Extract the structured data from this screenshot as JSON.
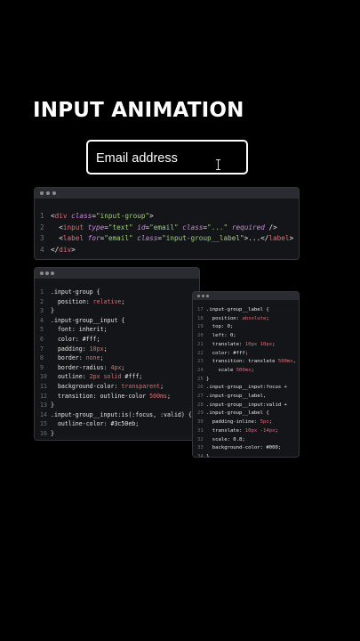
{
  "title": "INPUT ANIMATION",
  "input": {
    "label": "Email address"
  },
  "icons": {
    "cursor": "text-cursor-icon"
  },
  "window1": {
    "lines": [
      {
        "n": "1",
        "segs": [
          [
            "t",
            "<"
          ],
          [
            "tag",
            "div"
          ],
          [
            "t",
            " "
          ],
          [
            "attr",
            "class"
          ],
          [
            "t",
            "="
          ],
          [
            "str",
            "\"input-group\""
          ],
          [
            "t",
            ">"
          ]
        ]
      },
      {
        "n": "2",
        "segs": [
          [
            "t",
            "  <"
          ],
          [
            "tag",
            "input"
          ],
          [
            "t",
            " "
          ],
          [
            "attr",
            "type"
          ],
          [
            "t",
            "="
          ],
          [
            "str",
            "\"text\""
          ],
          [
            "t",
            " "
          ],
          [
            "attr",
            "id"
          ],
          [
            "t",
            "="
          ],
          [
            "str",
            "\"email\""
          ],
          [
            "t",
            " "
          ],
          [
            "attr",
            "class"
          ],
          [
            "t",
            "="
          ],
          [
            "str",
            "\"...\""
          ],
          [
            "t",
            " "
          ],
          [
            "attr",
            "required"
          ],
          [
            "t",
            " />"
          ]
        ]
      },
      {
        "n": "3",
        "segs": [
          [
            "t",
            "  <"
          ],
          [
            "tag",
            "label"
          ],
          [
            "t",
            " "
          ],
          [
            "attr",
            "for"
          ],
          [
            "t",
            "="
          ],
          [
            "str",
            "\"email\""
          ],
          [
            "t",
            " "
          ],
          [
            "attr",
            "class"
          ],
          [
            "t",
            "="
          ],
          [
            "str",
            "\"input-group__label\""
          ],
          [
            "t",
            ">...</"
          ],
          [
            "tag",
            "label"
          ],
          [
            "t",
            ">"
          ]
        ]
      },
      {
        "n": "4",
        "segs": [
          [
            "t",
            "</"
          ],
          [
            "tag",
            "div"
          ],
          [
            "t",
            ">"
          ]
        ]
      }
    ]
  },
  "window2": {
    "lines": [
      {
        "n": "1",
        "segs": [
          [
            "t",
            ".input-group {"
          ]
        ]
      },
      {
        "n": "2",
        "segs": [
          [
            "t",
            "  position: "
          ],
          [
            "kw",
            "relative"
          ],
          [
            "t",
            ";"
          ]
        ]
      },
      {
        "n": "3",
        "segs": [
          [
            "t",
            "}"
          ]
        ]
      },
      {
        "n": "4",
        "segs": [
          [
            "t",
            ".input-group__input {"
          ]
        ]
      },
      {
        "n": "5",
        "segs": [
          [
            "t",
            "  font: inherit;"
          ]
        ]
      },
      {
        "n": "6",
        "segs": [
          [
            "t",
            "  color: #fff;"
          ]
        ]
      },
      {
        "n": "7",
        "segs": [
          [
            "t",
            "  padding: "
          ],
          [
            "kw",
            "10px"
          ],
          [
            "t",
            ";"
          ]
        ]
      },
      {
        "n": "8",
        "segs": [
          [
            "t",
            "  border: "
          ],
          [
            "kw",
            "none"
          ],
          [
            "t",
            ";"
          ]
        ]
      },
      {
        "n": "9",
        "segs": [
          [
            "t",
            "  border-radius: "
          ],
          [
            "kw",
            "4px"
          ],
          [
            "t",
            ";"
          ]
        ]
      },
      {
        "n": "10",
        "segs": [
          [
            "t",
            "  outline: "
          ],
          [
            "kw",
            "2px"
          ],
          [
            "t",
            " "
          ],
          [
            "kw",
            "solid"
          ],
          [
            "t",
            " #fff;"
          ]
        ]
      },
      {
        "n": "11",
        "segs": [
          [
            "t",
            "  background-color: "
          ],
          [
            "kw",
            "transparent"
          ],
          [
            "t",
            ";"
          ]
        ]
      },
      {
        "n": "12",
        "segs": [
          [
            "t",
            "  transition: outline-color "
          ],
          [
            "kw",
            "500ms"
          ],
          [
            "t",
            ";"
          ]
        ]
      },
      {
        "n": "13",
        "segs": [
          [
            "t",
            "}"
          ]
        ]
      },
      {
        "n": "14",
        "segs": [
          [
            "t",
            ".input-group__input:is(:focus, :valid) {"
          ]
        ]
      },
      {
        "n": "15",
        "segs": [
          [
            "t",
            "  outline-color: #3c50eb;"
          ]
        ]
      },
      {
        "n": "16",
        "segs": [
          [
            "t",
            "}"
          ]
        ]
      }
    ]
  },
  "window3": {
    "lines": [
      {
        "n": "17",
        "segs": [
          [
            "t",
            ".input-group__label {"
          ]
        ]
      },
      {
        "n": "18",
        "segs": [
          [
            "t",
            "  position: "
          ],
          [
            "kw",
            "absolute"
          ],
          [
            "t",
            ";"
          ]
        ]
      },
      {
        "n": "19",
        "segs": [
          [
            "t",
            "  top: 0;"
          ]
        ]
      },
      {
        "n": "20",
        "segs": [
          [
            "t",
            "  left: 0;"
          ]
        ]
      },
      {
        "n": "21",
        "segs": [
          [
            "t",
            "  translate: "
          ],
          [
            "kw",
            "10px 10px"
          ],
          [
            "t",
            ";"
          ]
        ]
      },
      {
        "n": "22",
        "segs": [
          [
            "t",
            "  color: #fff;"
          ]
        ]
      },
      {
        "n": "23",
        "segs": [
          [
            "t",
            "  transition: translate "
          ],
          [
            "kw",
            "500ms"
          ],
          [
            "t",
            ","
          ]
        ]
      },
      {
        "n": "24",
        "segs": [
          [
            "t",
            "    scale "
          ],
          [
            "kw",
            "500ms"
          ],
          [
            "t",
            ";"
          ]
        ]
      },
      {
        "n": "25",
        "segs": [
          [
            "t",
            "}"
          ]
        ]
      },
      {
        "n": "26",
        "segs": [
          [
            "t",
            ".input-group__input:focus +"
          ]
        ]
      },
      {
        "n": "27",
        "segs": [
          [
            "t",
            ".input-group__label,"
          ]
        ]
      },
      {
        "n": "28",
        "segs": [
          [
            "t",
            ".input-group__input:valid +"
          ]
        ]
      },
      {
        "n": "29",
        "segs": [
          [
            "t",
            ".input-group__label {"
          ]
        ]
      },
      {
        "n": "30",
        "segs": [
          [
            "t",
            "  padding-inline: "
          ],
          [
            "kw",
            "5px"
          ],
          [
            "t",
            ";"
          ]
        ]
      },
      {
        "n": "31",
        "segs": [
          [
            "t",
            "  translate: "
          ],
          [
            "kw",
            "10px -14px"
          ],
          [
            "t",
            ";"
          ]
        ]
      },
      {
        "n": "32",
        "segs": [
          [
            "t",
            "  scale: 0.8;"
          ]
        ]
      },
      {
        "n": "33",
        "segs": [
          [
            "t",
            "  background-color: #000;"
          ]
        ]
      },
      {
        "n": "34",
        "segs": [
          [
            "t",
            "}"
          ]
        ]
      }
    ]
  }
}
